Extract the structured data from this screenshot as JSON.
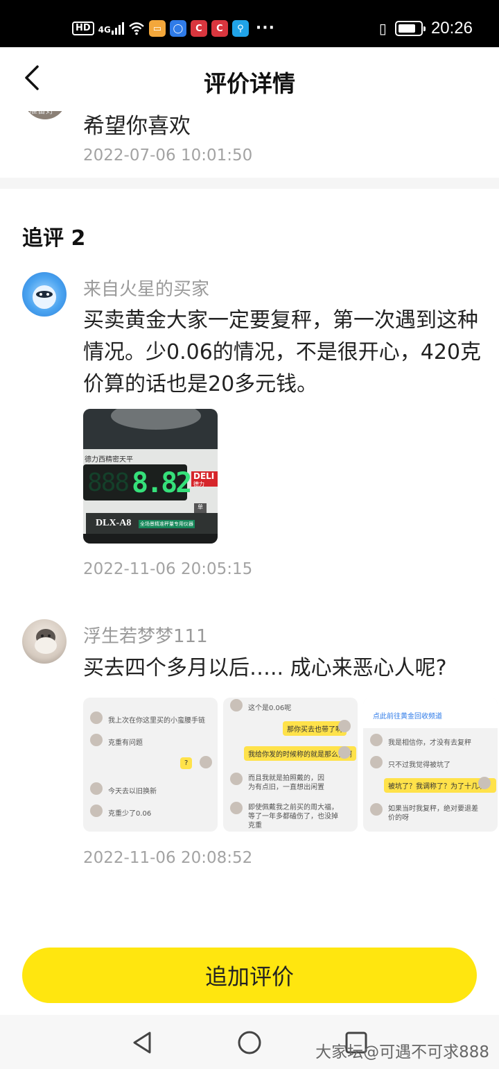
{
  "status_bar": {
    "hd": "HD",
    "network": "4G",
    "app_badges": [
      "C",
      "C"
    ],
    "dots": "···",
    "time": "20:26",
    "battery_level": 0.8
  },
  "header": {
    "title": "评价详情"
  },
  "previous": {
    "text": "希望你喜欢",
    "timestamp": "2022-07-06 10:01:50"
  },
  "section": {
    "title": "追评 2"
  },
  "reviews": [
    {
      "username": "来自火星的买家",
      "text": "买卖黄金大家一定要复秤，第一次遇到这种情况。少0.06的情况，不是很开心，420克价算的话也是20多元钱。",
      "photo": {
        "display": "8.82",
        "brand": "DELI",
        "brand_cn": "德力",
        "scale_label": "德力西精密天平",
        "model": "DLX-A8",
        "caption": "全场景精准秤量专用仪器"
      },
      "timestamp": "2022-11-06 20:05:15"
    },
    {
      "username": "浮生若梦梦111",
      "text": "买去四个多月以后….. 成心来恶心人呢?",
      "thumbs": [
        {
          "lines": [
            "我上次在你这里买的小蛮腰手链",
            "克重有问题",
            "今天去以旧换新",
            "克重少了0.06"
          ],
          "reply": "?"
        },
        {
          "lines": [
            "这个是0.06呢",
            "而且我就是拍照戴的，因为有点旧，一直想出闲置",
            "即使佩戴我之前买的周大福，等了一年多都磕伤了，也没掉克重"
          ],
          "replies": [
            "那你买去也带了啊",
            "我给你发的时候称的就是那么多啊"
          ]
        },
        {
          "header": "点此前往黄金回收频道",
          "lines": [
            "我是相信你，才没有去复秤",
            "只不过我觉得被坑了",
            "如果当时我复秤，绝对要退差价的呀"
          ],
          "reply": "被坑了？我调称了？为了十几块？"
        }
      ],
      "timestamp": "2022-11-06 20:08:52"
    }
  ],
  "action_button": {
    "label": "追加评价"
  },
  "watermark": "大家坛@可遇不可求888"
}
